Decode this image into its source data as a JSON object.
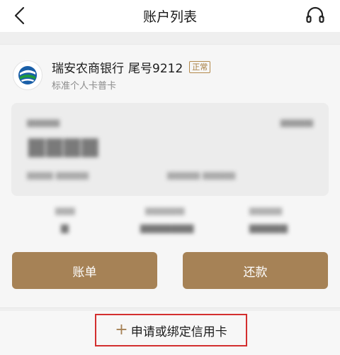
{
  "header": {
    "title": "账户列表"
  },
  "card": {
    "bank_name": "瑞安农商银行",
    "tail_label": "尾号9212",
    "status": "正常",
    "card_type": "标准个人卡普卡"
  },
  "actions": {
    "bill_label": "账单",
    "repay_label": "还款"
  },
  "footer": {
    "apply_label": "申请或绑定信用卡"
  }
}
